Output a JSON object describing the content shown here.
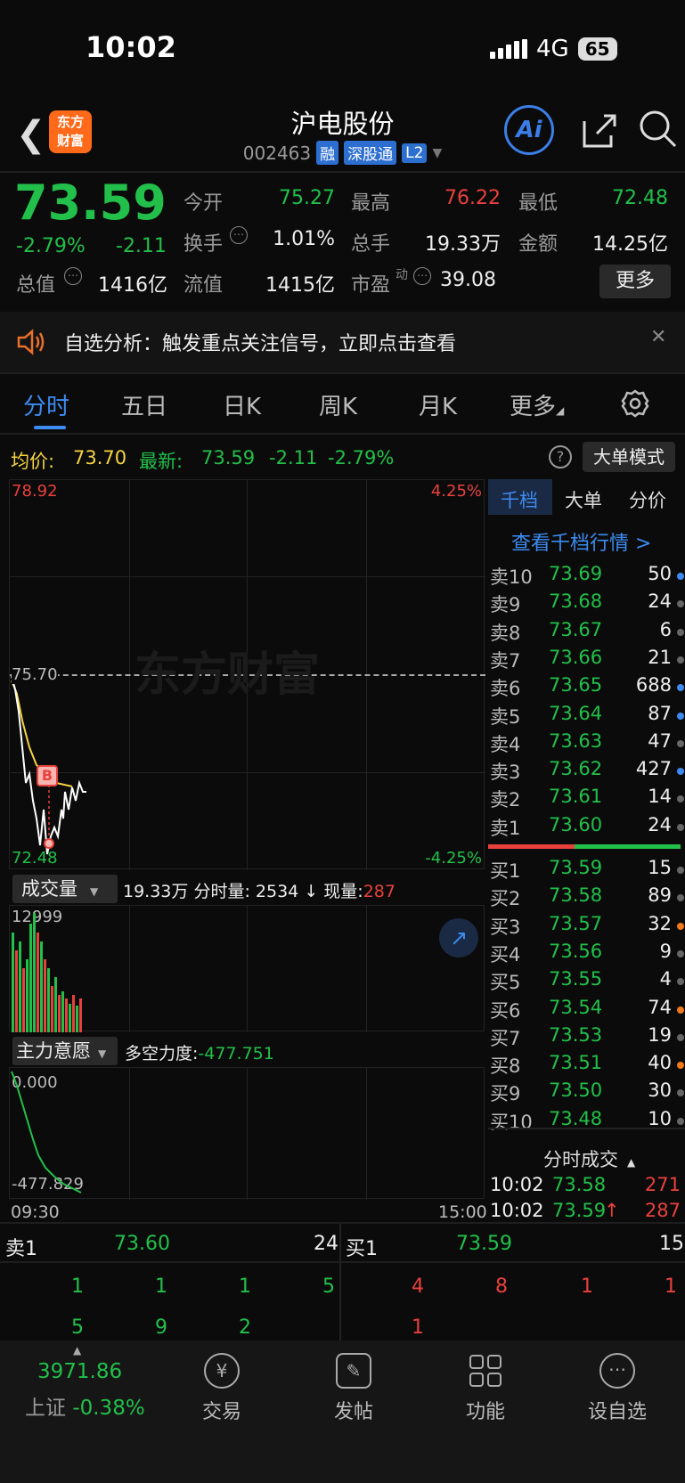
{
  "status": {
    "time": "10:02",
    "network": "4G",
    "battery": "65"
  },
  "header": {
    "logo": "东方财富",
    "title": "沪电股份",
    "code": "002463",
    "tags": [
      "融",
      "深股通",
      "L2"
    ],
    "ai_label": "Ai"
  },
  "quote": {
    "price": "73.59",
    "change_pct": "-2.79%",
    "change": "-2.11",
    "open_label": "今开",
    "open": "75.27",
    "high_label": "最高",
    "high": "76.22",
    "low_label": "最低",
    "low": "72.48",
    "turnover_label": "换手",
    "turnover": "1.01%",
    "volume_label": "总手",
    "volume": "19.33万",
    "amount_label": "金额",
    "amount": "14.25亿",
    "mktcap_label": "总值",
    "mktcap": "1416亿",
    "float_label": "流值",
    "float": "1415亿",
    "pe_label": "市盈",
    "pe_sup": "动",
    "pe": "39.08",
    "more_label": "更多"
  },
  "alert": {
    "text": "自选分析：触发重点关注信号，立即点击查看"
  },
  "tabs": [
    "分时",
    "五日",
    "日K",
    "周K",
    "月K",
    "更多"
  ],
  "info": {
    "avg_label": "均价:",
    "avg": "73.70",
    "last_label": "最新:",
    "last": "73.59",
    "chg": "-2.11",
    "chg_pct": "-2.79%",
    "mode_btn": "大单模式"
  },
  "chart": {
    "y_top": "78.92",
    "y_mid": "75.70",
    "y_bot": "72.48",
    "pct_top": "4.25%",
    "pct_bot": "-4.25%",
    "watermark": "东方财富",
    "marker": "B",
    "vol_selector": "成交量",
    "vol_total": "19.33万",
    "vol_min_label": "分时量:",
    "vol_min": "2534",
    "vol_now_label": "现量:",
    "vol_now": "287",
    "vol_max": "12999",
    "ind_selector": "主力意愿",
    "ind_label": "多空力度:",
    "ind_value": "-477.751",
    "ind_top": "0.000",
    "ind_bot": "-477.829",
    "time_start": "09:30",
    "time_end": "15:00"
  },
  "orderbook": {
    "tabs": [
      "千档",
      "大单",
      "分价"
    ],
    "link": "查看千档行情 >",
    "asks": [
      {
        "label": "卖10",
        "price": "73.69",
        "vol": "50",
        "dot": "#3d8bf0"
      },
      {
        "label": "卖9",
        "price": "73.68",
        "vol": "24",
        "dot": "#666"
      },
      {
        "label": "卖8",
        "price": "73.67",
        "vol": "6",
        "dot": "#666"
      },
      {
        "label": "卖7",
        "price": "73.66",
        "vol": "21",
        "dot": "#666"
      },
      {
        "label": "卖6",
        "price": "73.65",
        "vol": "688",
        "dot": "#3d8bf0"
      },
      {
        "label": "卖5",
        "price": "73.64",
        "vol": "87",
        "dot": "#3d8bf0"
      },
      {
        "label": "卖4",
        "price": "73.63",
        "vol": "47",
        "dot": "#666"
      },
      {
        "label": "卖3",
        "price": "73.62",
        "vol": "427",
        "dot": "#3d8bf0"
      },
      {
        "label": "卖2",
        "price": "73.61",
        "vol": "14",
        "dot": "#666"
      },
      {
        "label": "卖1",
        "price": "73.60",
        "vol": "24",
        "dot": "#666"
      }
    ],
    "bids": [
      {
        "label": "买1",
        "price": "73.59",
        "vol": "15",
        "dot": "#666"
      },
      {
        "label": "买2",
        "price": "73.58",
        "vol": "89",
        "dot": "#666"
      },
      {
        "label": "买3",
        "price": "73.57",
        "vol": "32",
        "dot": "#f07a1a"
      },
      {
        "label": "买4",
        "price": "73.56",
        "vol": "9",
        "dot": "#666"
      },
      {
        "label": "买5",
        "price": "73.55",
        "vol": "4",
        "dot": "#666"
      },
      {
        "label": "买6",
        "price": "73.54",
        "vol": "74",
        "dot": "#f07a1a"
      },
      {
        "label": "买7",
        "price": "73.53",
        "vol": "19",
        "dot": "#666"
      },
      {
        "label": "买8",
        "price": "73.51",
        "vol": "40",
        "dot": "#f07a1a"
      },
      {
        "label": "买9",
        "price": "73.50",
        "vol": "30",
        "dot": "#666"
      },
      {
        "label": "买10",
        "price": "73.48",
        "vol": "10",
        "dot": "#666"
      }
    ],
    "ticks_label": "分时成交",
    "ticks": [
      {
        "time": "10:02",
        "price": "73.58",
        "arrow": "",
        "vol": "271"
      },
      {
        "time": "10:02",
        "price": "73.59",
        "arrow": "↑",
        "vol": "287"
      }
    ]
  },
  "quick": {
    "sell_label": "卖1",
    "sell_price": "73.60",
    "sell_vol": "24",
    "buy_label": "买1",
    "buy_price": "73.59",
    "buy_vol": "15",
    "sell_queue": [
      "1",
      "1",
      "1",
      "5",
      "5",
      "9",
      "2"
    ],
    "buy_queue": [
      "4",
      "8",
      "1",
      "1",
      "1"
    ]
  },
  "nav": {
    "index_value": "3971.86",
    "index_name": "上证",
    "index_chg": "-0.38%",
    "items": [
      "交易",
      "发帖",
      "功能",
      "设自选"
    ]
  }
}
